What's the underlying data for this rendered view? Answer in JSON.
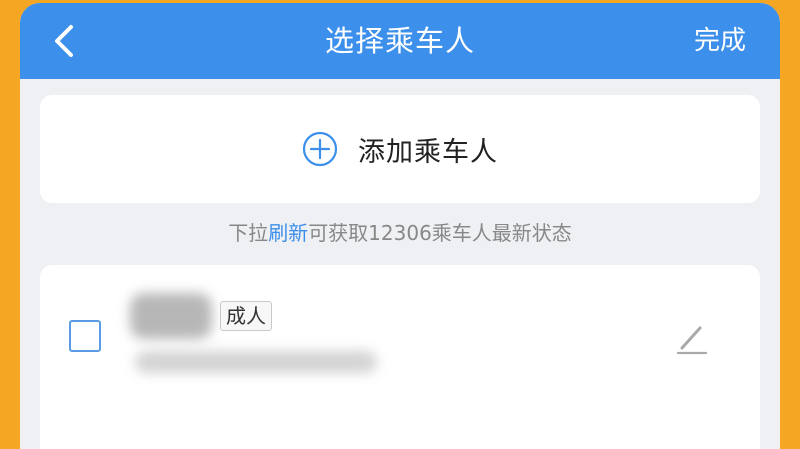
{
  "header": {
    "title": "选择乘车人",
    "done_label": "完成",
    "back_icon": "chevron-left-icon"
  },
  "add_passenger": {
    "label": "添加乘车人",
    "icon": "plus-circle-icon"
  },
  "hint": {
    "prefix": "下拉",
    "link": "刷新",
    "suffix": "可获取12306乘车人最新状态"
  },
  "passengers": [
    {
      "type_badge": "成人",
      "checked": false,
      "edit_icon": "pencil-icon"
    }
  ],
  "colors": {
    "header_bg": "#3C8FEA",
    "background": "#F5A623",
    "accent": "#3C8FEA"
  }
}
